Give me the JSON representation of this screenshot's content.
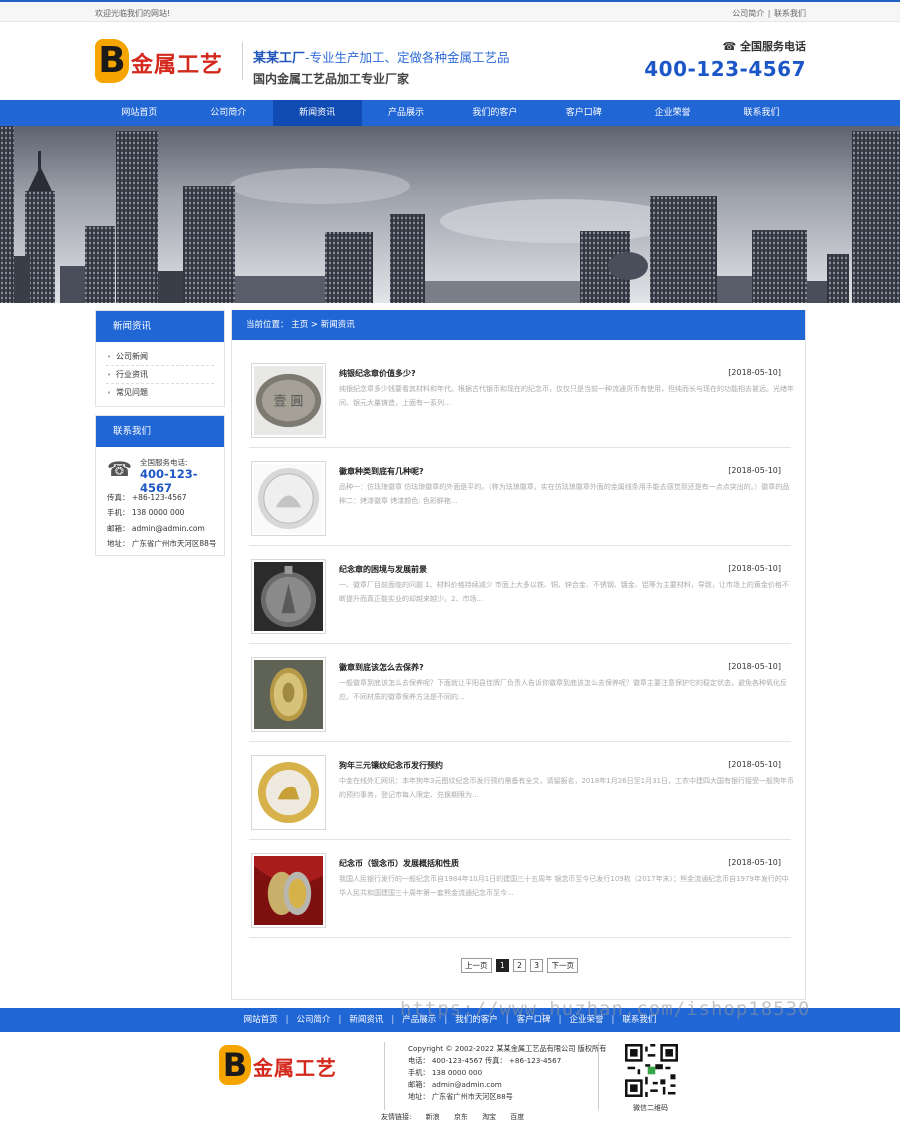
{
  "topbar": {
    "welcome": "欢迎光临我们的网站!",
    "links": [
      "公司简介",
      "联系我们"
    ],
    "sep": "|"
  },
  "header": {
    "logo_letter": "B",
    "logo_text": "金属工艺",
    "slogan_brand": "某某工厂",
    "slogan_line1": "-专业生产加工、定做各种金属工艺品",
    "slogan_line2": "国内金属工艺品加工专业厂家",
    "hotline_label": "全国服务电话",
    "hotline_number": "400-123-4567"
  },
  "nav": {
    "items": [
      "网站首页",
      "公司简介",
      "新闻资讯",
      "产品展示",
      "我们的客户",
      "客户口碑",
      "企业荣誉",
      "联系我们"
    ],
    "active_index": 2
  },
  "sidebar": {
    "news_title": "新闻资讯",
    "categories": [
      "公司新闻",
      "行业资讯",
      "常见问题"
    ],
    "contact_title": "联系我们",
    "phone_label": "全国服务电话:",
    "phone_number": "400-123-4567",
    "fax": "传真： +86-123-4567",
    "mobile": "手机： 138 0000 000",
    "email": "邮箱： admin@admin.com",
    "address": "地址： 广东省广州市天河区88号"
  },
  "main": {
    "breadcrumb": "当前位置： 主页 > 新闻资讯",
    "news": [
      {
        "title": "纯银纪念章价值多少?",
        "date": "[2018-05-10]",
        "desc": "纯银纪念章多少钱要看其材料和年代。根据古代银币和现在的纪念币，仅仅只是当前一种流通货币有使用，但纯而长与现在的功能相去甚远。光绪年间、银元大量铸造，上面有一系列...",
        "thumb": "silver"
      },
      {
        "title": "徽章种类到底有几种呢?",
        "date": "[2018-05-10]",
        "desc": "品种一：仿珐琅徽章 仿珐琅徽章的外面是平的。（称为珐琅徽章，实在仿珐琅徽章外面的金属线条用手能去感觉到还是有一点点突出的。）徽章的品种二：烤漆徽章 烤漆颜色: 色彩鲜艳...",
        "thumb": "white"
      },
      {
        "title": "纪念章的困境与发展前景",
        "date": "[2018-05-10]",
        "desc": "一、徽章厂目前面临的问题 1、材料价格持续减少 市面上大多以铁、铜、锌合金、不锈钢、镀金、铝等为主要材料，导致，让市场上的黄金价格不断提升而真正能实业的却越来越少。2、市场...",
        "thumb": "bronze"
      },
      {
        "title": "徽章到底该怎么去保养?",
        "date": "[2018-05-10]",
        "desc": "一般徽章到底该怎么去保养呢？下面就让平阳县佳牌厂负责人告诉你徽章到底该怎么去保养呢？徽章主要注意保护它的稳定状态，避免各种氧化反应。不同材质的徽章保养方法是不同的...",
        "thumb": "oval"
      },
      {
        "title": "狗年三元镶纹纪念币发行预约",
        "date": "[2018-05-10]",
        "desc": "中金在线外汇网讯：本年狗年3元图纹纪念币发行预约需备有全文，请留报名，2018年1月26日至1月31日，工农中建四大国有银行接受一般狗年币的预约事务，登记市每人限定、兑换期限为...",
        "thumb": "gold"
      },
      {
        "title": "纪念币（银念币）发展概括和性质",
        "date": "[2018-05-10]",
        "desc": "我国人民银行发行的一般纪念币自1984年10月1日的建国三十五周年 银念币至今已发行109枚（2017年末）；熊金流通纪念币自1979年发行的中华人民共和国建国三十周年第一套熊金流通纪念币至今...",
        "thumb": "red"
      }
    ],
    "pager": {
      "prev": "上一页",
      "pages": [
        "1",
        "2",
        "3"
      ],
      "current": "1",
      "next": "下一页"
    }
  },
  "footer": {
    "nav": [
      "网站首页",
      "公司简介",
      "新闻资讯",
      "产品展示",
      "我们的客户",
      "客户口碑",
      "企业荣誉",
      "联系我们"
    ],
    "copyright": "Copyright © 2002-2022 某某金属工艺品有限公司 版权所有",
    "phone_fax": "电话： 400-123-4567 传真： +86-123-4567",
    "mobile": "手机： 138 0000 000",
    "email": "邮箱： admin@admin.com",
    "address": "地址： 广东省广州市天河区88号",
    "qr_label": "微信二维码",
    "friends_label": "友情链接:",
    "friends": [
      "新浪",
      "京东",
      "淘宝",
      "百度"
    ]
  },
  "watermark": "https://www.huzhan.com/ishop18530",
  "colors": {
    "primary": "#2166d5",
    "active": "#0f4bb2",
    "logo_red": "#d4281d",
    "logo_gold": "#f5a400"
  }
}
